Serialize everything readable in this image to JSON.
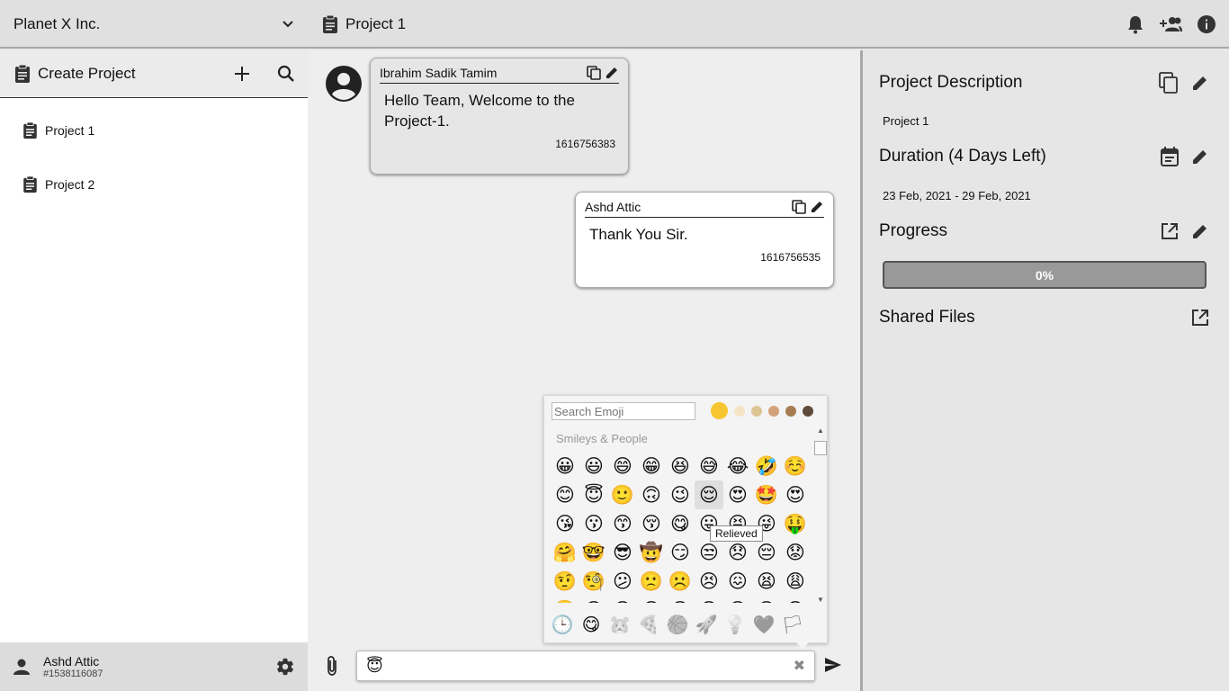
{
  "header": {
    "org_name": "Planet X Inc.",
    "project_title": "Project 1"
  },
  "sidebar": {
    "create_label": "Create Project",
    "items": [
      {
        "label": "Project 1"
      },
      {
        "label": "Project 2"
      }
    ],
    "user": {
      "name": "Ashd Attic",
      "id": "#1538116087"
    }
  },
  "messages": [
    {
      "author": "Ibrahim Sadik Tamim",
      "text": "Hello Team, Welcome to the Project-1.",
      "timestamp": "1616756383"
    },
    {
      "author": "Ashd Attic",
      "text": "Thank You Sir.",
      "timestamp": "1616756535"
    }
  ],
  "emoji_picker": {
    "search_placeholder": "Search Emoji",
    "category_title": "Smileys & People",
    "tooltip": "Relieved",
    "skin_tones": [
      "#f7c530",
      "#f5e3c6",
      "#e0c594",
      "#d3a27c",
      "#a67c52",
      "#5e4a3a"
    ],
    "emojis": [
      "😀",
      "😃",
      "😄",
      "😁",
      "😆",
      "😅",
      "😂",
      "🤣",
      "☺️",
      "😊",
      "😇",
      "🙂",
      "🙃",
      "😉",
      "😌",
      "😍",
      "🤩",
      "😍",
      "😘",
      "😗",
      "😙",
      "😚",
      "😋",
      "😛",
      "😝",
      "😜",
      "🤑",
      "🤗",
      "🤓",
      "😎",
      "🤠",
      "😏",
      "😒",
      "😞",
      "😔",
      "😟",
      "🤨",
      "🧐",
      "😕",
      "🙁",
      "☹️",
      "😣",
      "😖",
      "😫",
      "😩",
      "😤",
      "😠",
      "😡",
      "😡",
      "😶",
      "😐",
      "😑",
      "😯",
      "😦"
    ],
    "categories": [
      "🕒",
      "😋",
      "🐹",
      "🍕",
      "🏀",
      "🚀",
      "💡",
      "🖤",
      "🏳"
    ]
  },
  "composer": {
    "value": "😇"
  },
  "details": {
    "description_title": "Project Description",
    "description_text": "Project 1",
    "duration_title": "Duration (4 Days Left)",
    "duration_text": "23 Feb, 2021 - 29 Feb, 2021",
    "progress_title": "Progress",
    "progress_label": "0%",
    "progress_value": 0,
    "files_title": "Shared Files"
  }
}
